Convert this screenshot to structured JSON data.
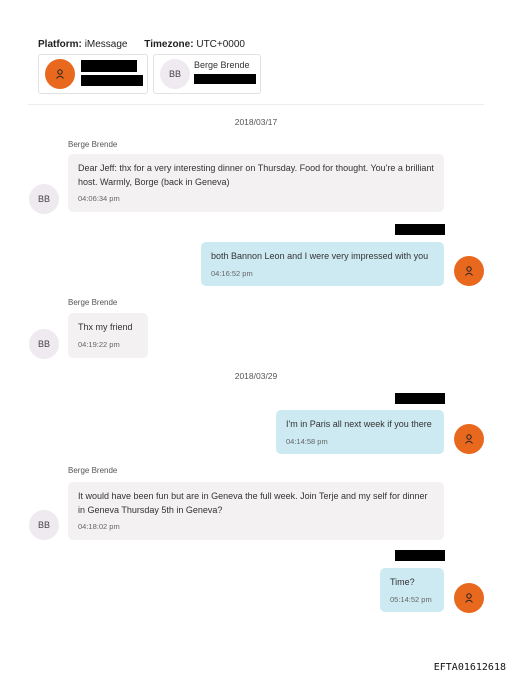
{
  "header": {
    "platform_label": "Platform:",
    "platform_value": "iMessage",
    "timezone_label": "Timezone:",
    "timezone_value": "UTC+0000"
  },
  "participants": [
    {
      "initials": "",
      "name": "",
      "redacted": true
    },
    {
      "initials": "BB",
      "name": "Berge Brende",
      "redacted": false
    }
  ],
  "conversation": [
    {
      "type": "date",
      "text": "2018/03/17"
    },
    {
      "type": "incoming",
      "sender": "Berge Brende",
      "initials": "BB",
      "text": "Dear Jeff: thx for a very interesting dinner on Thursday. Food for thought. You're a brilliant host. Warmly, Borge (back in Geneva)",
      "time": "04:06:34 pm"
    },
    {
      "type": "outgoing",
      "text": "both Bannon Leon and I were very impressed with you",
      "time": "04:16:52 pm"
    },
    {
      "type": "incoming",
      "sender": "Berge Brende",
      "initials": "BB",
      "text": "Thx my friend",
      "time": "04:19:22 pm"
    },
    {
      "type": "date",
      "text": "2018/03/29"
    },
    {
      "type": "outgoing",
      "text": "I'm in Paris all next week if you there",
      "time": "04:14:58 pm"
    },
    {
      "type": "incoming",
      "sender": "Berge Brende",
      "initials": "BB",
      "text": "It would have been fun but are in Geneva the full week. Join Terje and my self for dinner in Geneva Thursday 5th in Geneva?",
      "time": "04:18:02 pm"
    },
    {
      "type": "outgoing",
      "text": "Time?",
      "time": "05:14:52 pm"
    }
  ],
  "footer_id": "EFTA01612618",
  "colors": {
    "outgoing_bubble": "#cdeaf2",
    "incoming_bubble": "#f3f1f1",
    "avatar_accent": "#e8691e"
  }
}
